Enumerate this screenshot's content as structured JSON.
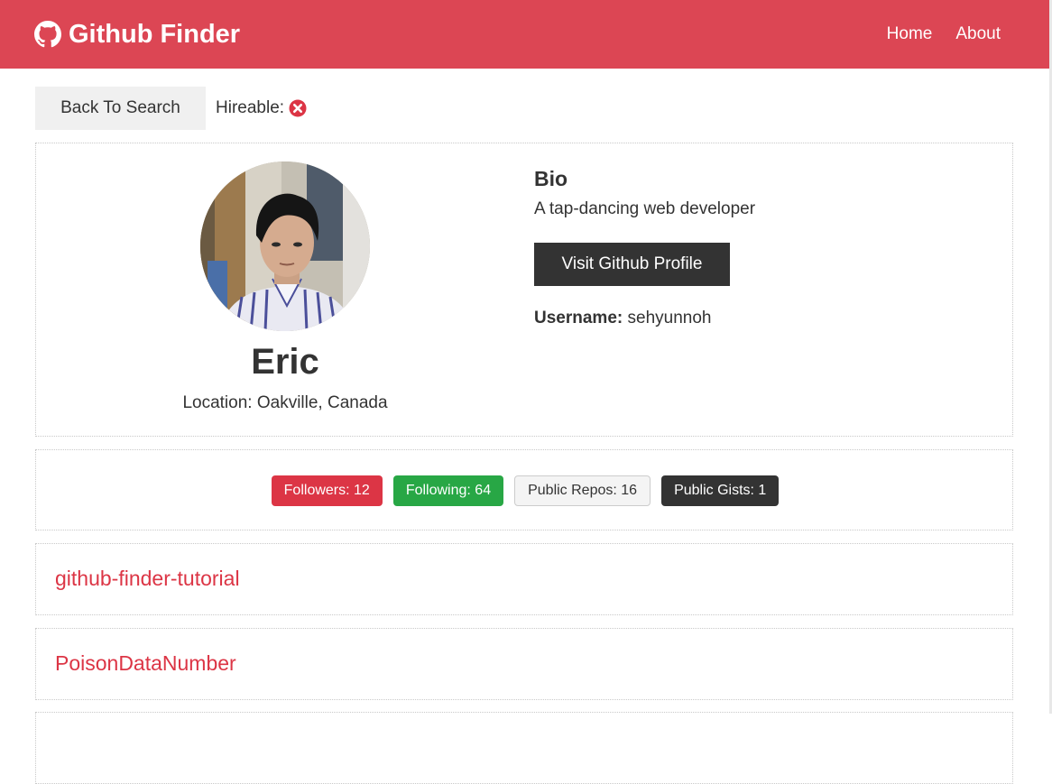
{
  "navbar": {
    "brand": "Github Finder",
    "links": [
      {
        "label": "Home"
      },
      {
        "label": "About"
      }
    ]
  },
  "toolbar": {
    "back_label": "Back To Search",
    "hireable_label": "Hireable:"
  },
  "profile": {
    "name": "Eric",
    "location": "Location: Oakville, Canada",
    "bio_heading": "Bio",
    "bio": "A tap-dancing web developer",
    "visit_label": "Visit Github Profile",
    "username_label": "Username:",
    "username": "sehyunnoh"
  },
  "stats": {
    "followers": "Followers: 12",
    "following": "Following: 64",
    "public_repos": "Public Repos: 16",
    "public_gists": "Public Gists: 1"
  },
  "repos": [
    {
      "name": "github-finder-tutorial"
    },
    {
      "name": "PoisonDataNumber"
    }
  ],
  "colors": {
    "navbar": "#dc4654",
    "primary": "#dc3545",
    "success": "#28a745",
    "dark": "#333333",
    "light": "#f4f4f4"
  }
}
